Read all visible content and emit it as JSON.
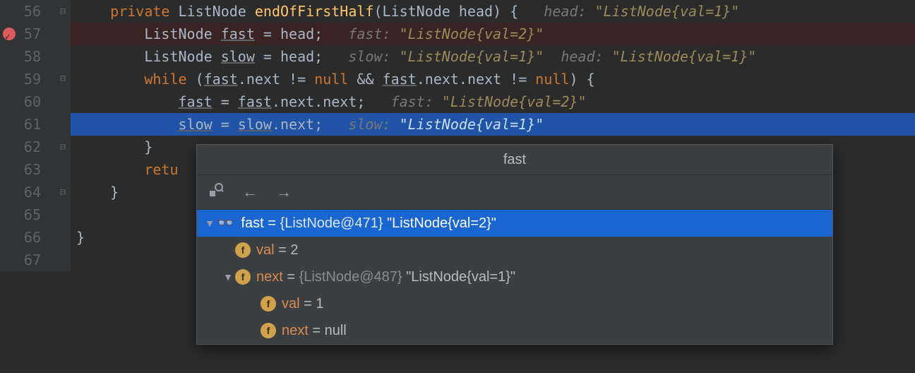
{
  "gutter": {
    "start": 56,
    "end": 67,
    "breakpoint_line": 57,
    "exec_line": 61
  },
  "code": {
    "l56": {
      "pre": "    ",
      "kw": "private",
      "type": " ListNode ",
      "method": "endOfFirstHalf",
      "sig": "(ListNode head) {",
      "hint_lbl": "   head: ",
      "hint_val": "\"ListNode{val=1}\""
    },
    "l57": {
      "pre": "        ",
      "type": "ListNode ",
      "var": "fast",
      "rest": " = head;",
      "hint_lbl": "   fast: ",
      "hint_val": "\"ListNode{val=2}\""
    },
    "l58": {
      "pre": "        ",
      "type": "ListNode ",
      "var": "slow",
      "rest": " = head;",
      "hint_lbl": "   slow: ",
      "hint_val": "\"ListNode{val=1}\"",
      "hint2_lbl": "  head: ",
      "hint2_val": "\"ListNode{val=1}\""
    },
    "l59": {
      "pre": "        ",
      "kw": "while",
      "paren": " (",
      "f1": "fast",
      "mid1": ".next != ",
      "null1": "null",
      "amp": " && ",
      "f2": "fast",
      "mid2": ".next.next != ",
      "null2": "null",
      "close": ") {"
    },
    "l60": {
      "pre": "            ",
      "lhs": "fast",
      "eq": " = ",
      "rhs1": "fast",
      "rhs2": ".next.next;",
      "hint_lbl": "   fast: ",
      "hint_val": "\"ListNode{val=2}\""
    },
    "l61": {
      "pre": "            ",
      "lhs": "slow",
      "eq": " = ",
      "rhs1": "slow",
      "rhs2": ".next;",
      "hint_lbl": "   slow: ",
      "hint_val": "\"ListNode{val=1}\""
    },
    "l62": {
      "pre": "        ",
      "brace": "}"
    },
    "l63": {
      "pre": "        ",
      "kw": "retu"
    },
    "l64": {
      "pre": "    ",
      "brace": "}"
    },
    "l65": {
      "pre": "",
      "blank": ""
    },
    "l66": {
      "pre": "",
      "brace": "}"
    },
    "l67": {
      "pre": "",
      "blank": ""
    }
  },
  "popup": {
    "title": "fast",
    "rows": [
      {
        "level": 0,
        "expanded": true,
        "icon": "glasses",
        "name": "fast",
        "eq": " = ",
        "grey": "{ListNode@471}",
        "str": " \"ListNode{val=2}\"",
        "selected": true
      },
      {
        "level": 1,
        "icon": "field",
        "name": "val",
        "eq": " = ",
        "str": "2"
      },
      {
        "level": 1,
        "expanded": true,
        "icon": "field",
        "name": "next",
        "eq": " = ",
        "grey": "{ListNode@487}",
        "str": " \"ListNode{val=1}\""
      },
      {
        "level": 2,
        "icon": "field",
        "name": "val",
        "eq": " = ",
        "str": "1"
      },
      {
        "level": 2,
        "icon": "field",
        "name": "next",
        "eq": " = ",
        "str": "null"
      }
    ]
  }
}
